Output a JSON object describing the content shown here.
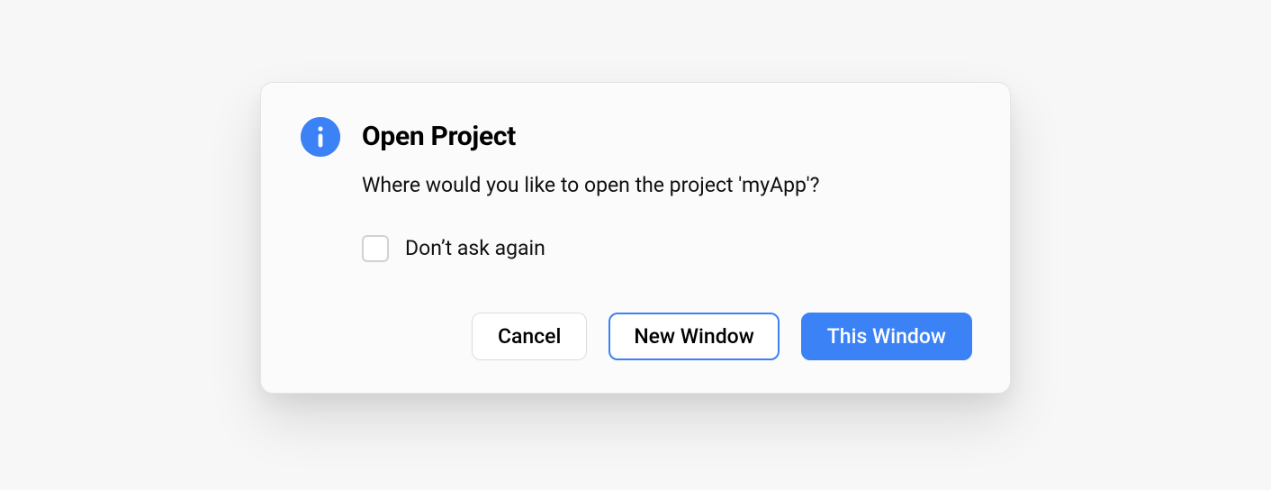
{
  "dialog": {
    "title": "Open Project",
    "message": "Where would you like to open the project 'myApp'?",
    "checkbox_label": "Don’t ask again",
    "checkbox_checked": false,
    "actions": {
      "cancel": "Cancel",
      "new_window": "New Window",
      "this_window": "This Window"
    }
  },
  "colors": {
    "accent": "#3b82f6",
    "page_bg": "#f7f7f8",
    "dialog_bg": "#fbfbfc",
    "border": "#dcdce0"
  }
}
